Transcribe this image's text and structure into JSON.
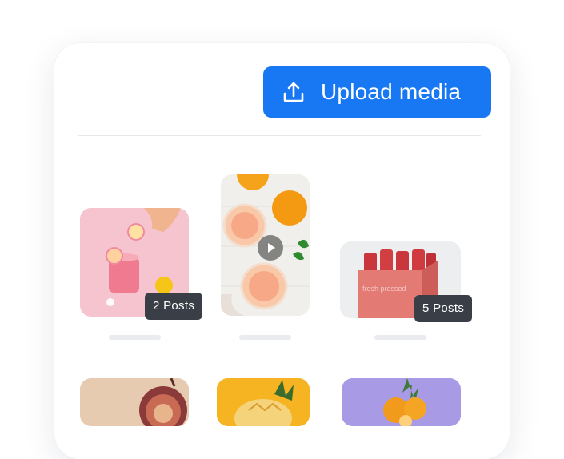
{
  "toolbar": {
    "upload_label": "Upload media",
    "upload_icon": "upload-icon"
  },
  "colors": {
    "accent": "#1877f2",
    "badge": "#3a3f47",
    "placeholder": "#e9ebee"
  },
  "media": [
    {
      "id": "pink-grapefruit-drink",
      "badge": "2 Posts"
    },
    {
      "id": "orange-drinks-video",
      "badge": ""
    },
    {
      "id": "red-bottles-pack",
      "badge": "5 Posts",
      "pack_text": "fresh pressed"
    },
    {
      "id": "fig",
      "badge": ""
    },
    {
      "id": "pineapple",
      "badge": ""
    },
    {
      "id": "orange-pineapple-purple",
      "badge": ""
    }
  ]
}
